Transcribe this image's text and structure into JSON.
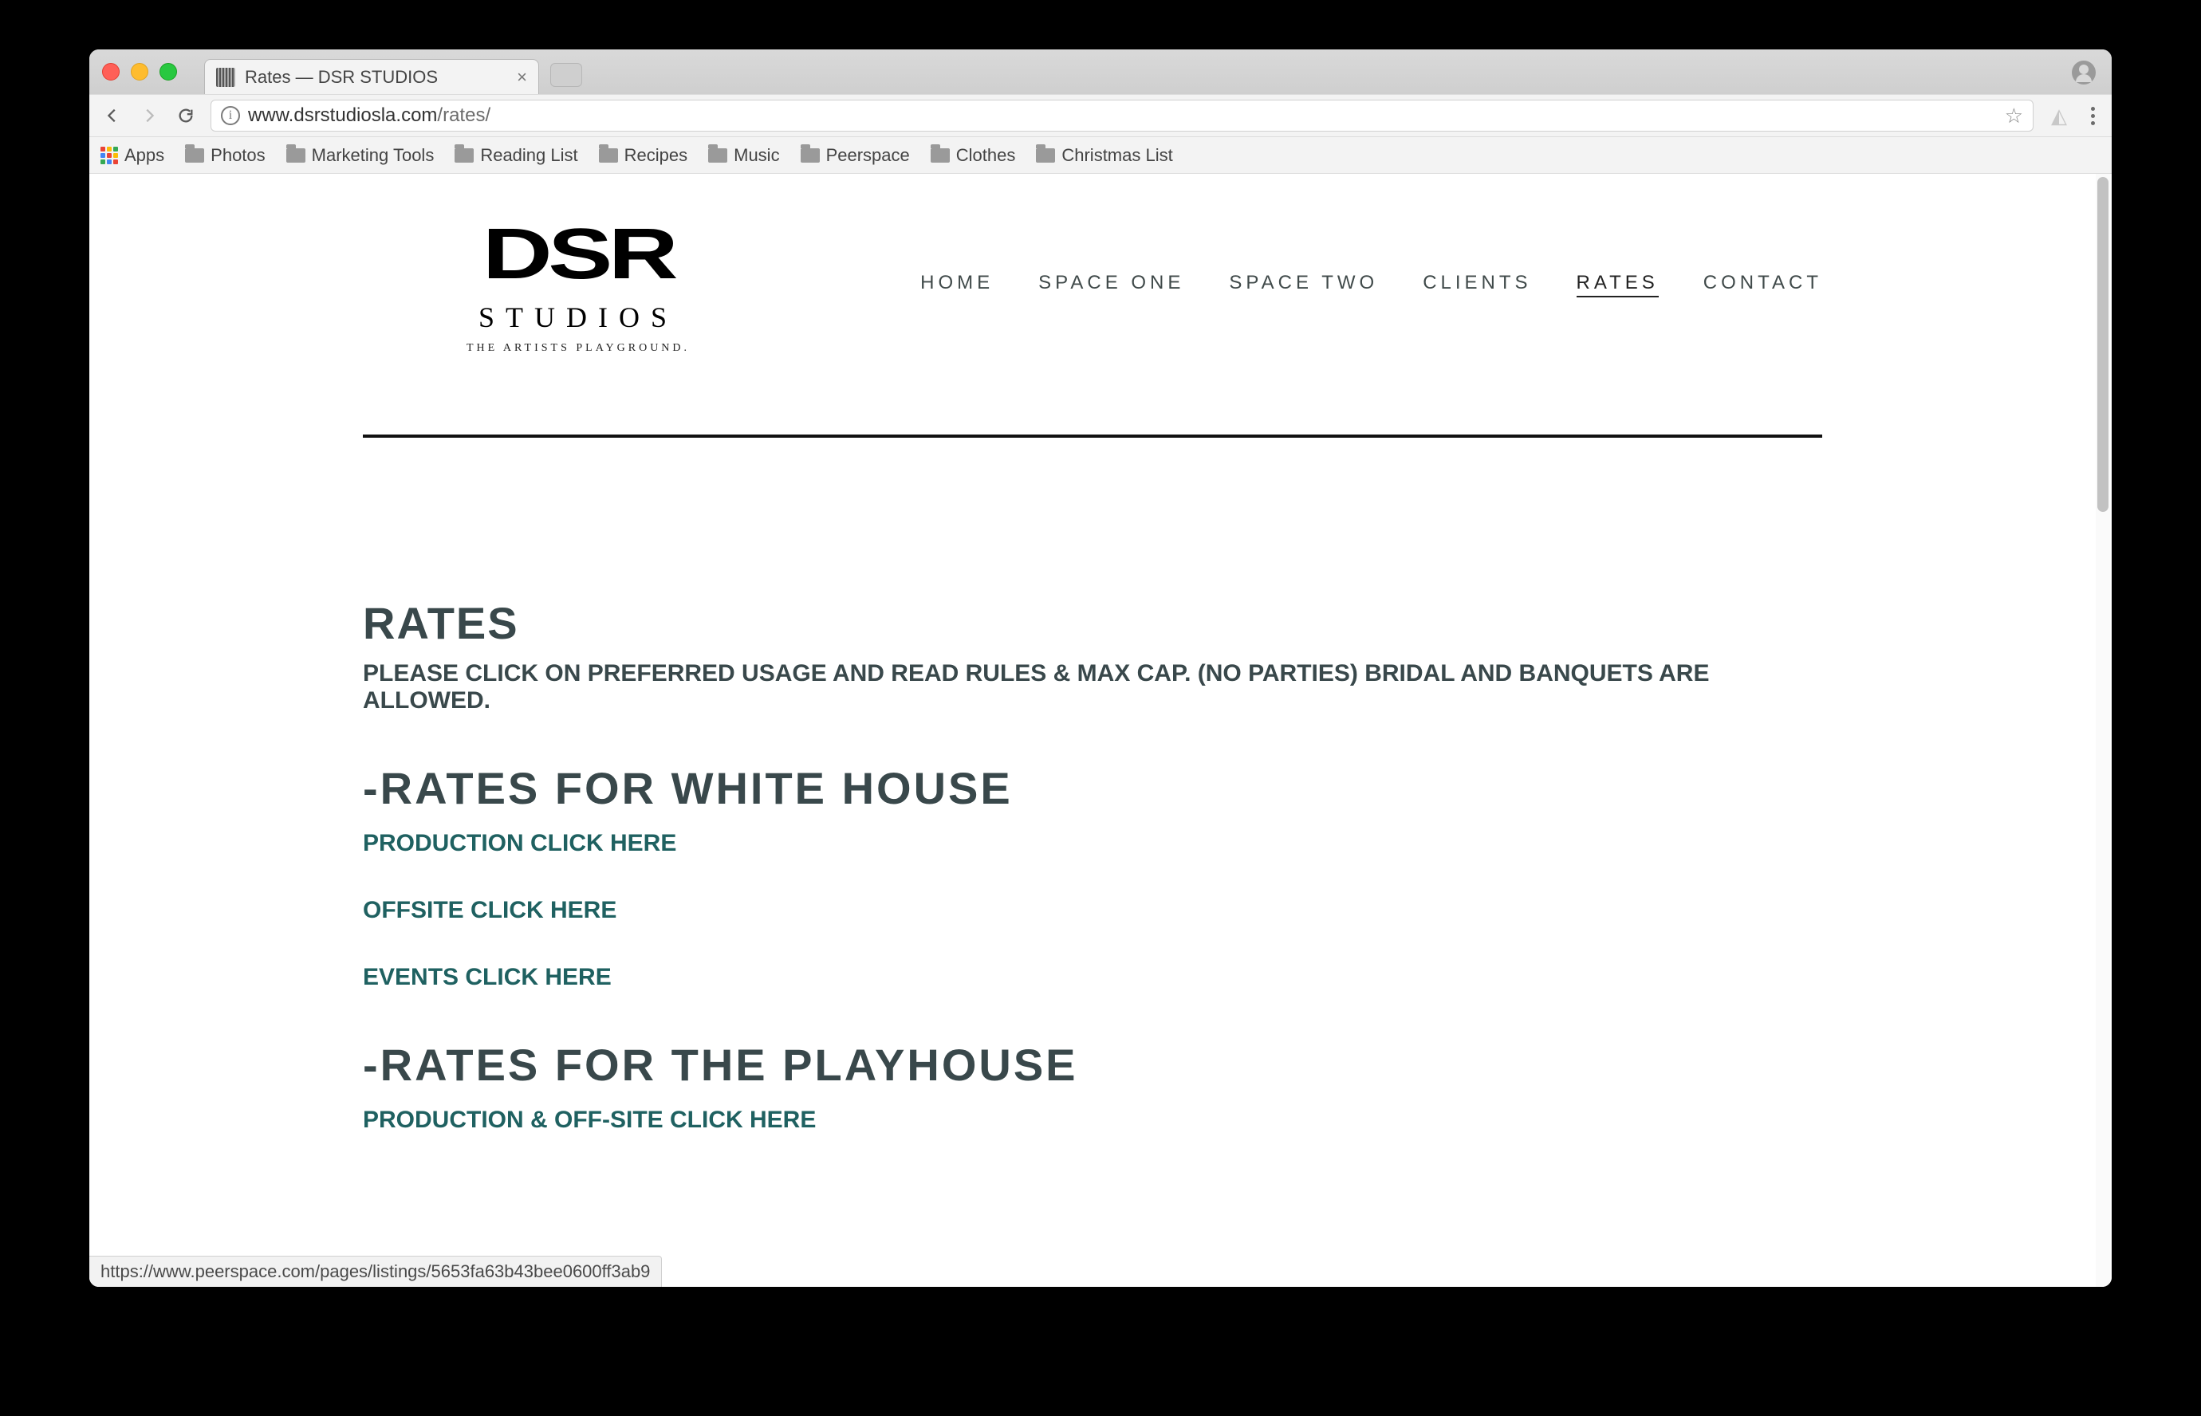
{
  "browser": {
    "tab_title": "Rates — DSR STUDIOS",
    "url_host": "www.dsrstudiosla.com",
    "url_path": "/rates/",
    "status_text": "https://www.peerspace.com/pages/listings/5653fa63b43bee0600ff3ab9"
  },
  "bookmarks": {
    "apps_label": "Apps",
    "items": [
      "Photos",
      "Marketing Tools",
      "Reading List",
      "Recipes",
      "Music",
      "Peerspace",
      "Clothes",
      "Christmas List"
    ]
  },
  "logo": {
    "main": "DSR",
    "sub": "STUDIOS",
    "tag": "THE ARTISTS PLAYGROUND."
  },
  "nav": [
    {
      "label": "HOME",
      "active": false
    },
    {
      "label": "SPACE ONE",
      "active": false
    },
    {
      "label": "SPACE TWO",
      "active": false
    },
    {
      "label": "CLIENTS",
      "active": false
    },
    {
      "label": "RATES",
      "active": true
    },
    {
      "label": "CONTACT",
      "active": false
    }
  ],
  "content": {
    "heading": "RATES",
    "subline": "PLEASE CLICK ON PREFERRED USAGE AND READ RULES & MAX CAP. (NO PARTIES) BRIDAL AND BANQUETS ARE ALLOWED.",
    "section1_heading": "-RATES FOR WHITE HOUSE",
    "section1_links": [
      "PRODUCTION CLICK HERE",
      "OFFSITE CLICK HERE",
      "EVENTS CLICK HERE"
    ],
    "section2_heading": "-RATES FOR THE PLAYHOUSE",
    "section2_links": [
      "PRODUCTION & OFF-SITE CLICK HERE"
    ]
  }
}
